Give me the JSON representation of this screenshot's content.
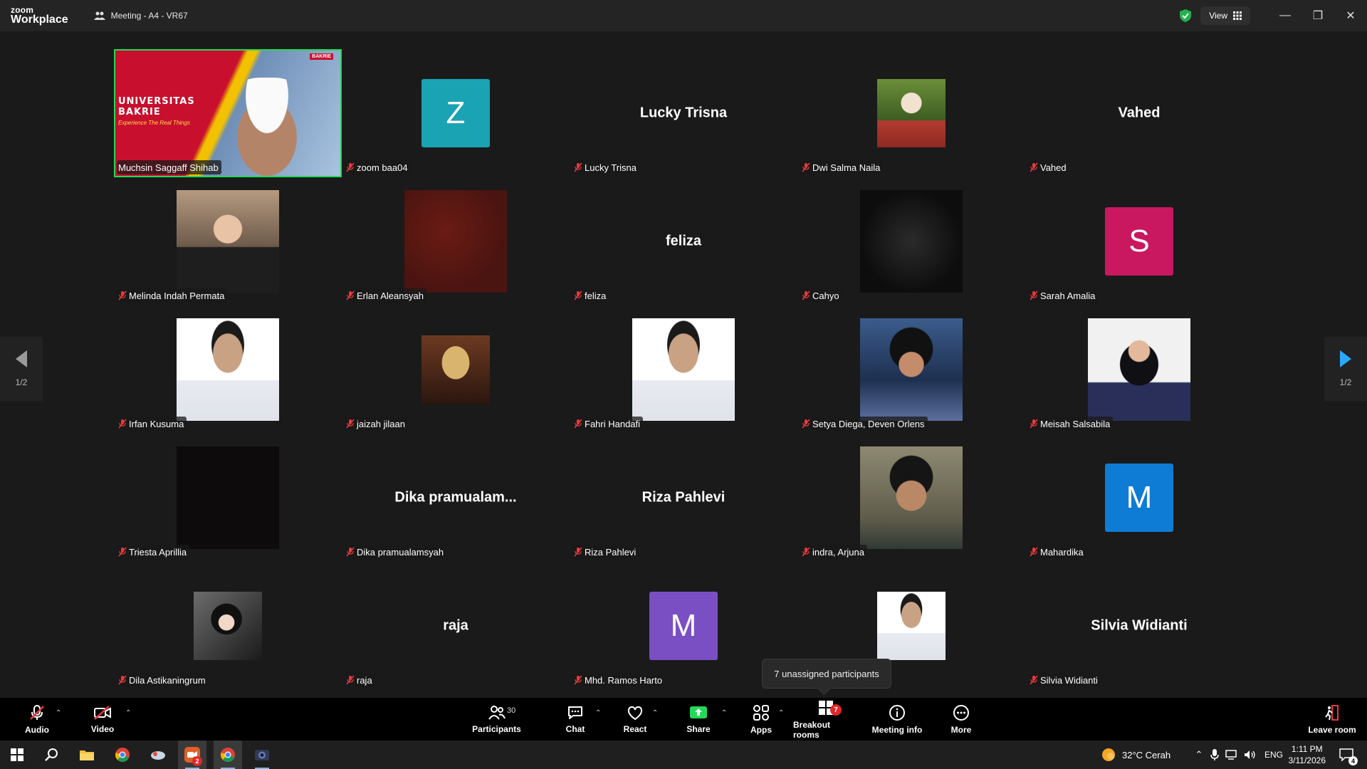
{
  "titlebar": {
    "brand_top": "zoom",
    "brand_bottom": "Workplace",
    "meeting_title": "Meeting - A4 - VR67",
    "view_label": "View"
  },
  "tiles": [
    {
      "name": "Muchsin Saggaff Shihab",
      "kind": "video",
      "theme": "univ",
      "active": true,
      "muted": false,
      "banner": {
        "line1": "UNIVERSITAS",
        "line2": "BAKRIE",
        "tagline": "Experience The Real Things",
        "logo": "BAKRIE"
      }
    },
    {
      "name": "zoom baa04",
      "kind": "avatar",
      "letter": "Z",
      "color": "#1aa3b3"
    },
    {
      "name": "Lucky Trisna",
      "kind": "text",
      "display": "Lucky Trisna"
    },
    {
      "name": "Dwi Salma Naila",
      "kind": "video",
      "theme": "grass",
      "small": true
    },
    {
      "name": "Vahed",
      "kind": "text",
      "display": "Vahed"
    },
    {
      "name": "Melinda Indah Permata",
      "kind": "video",
      "theme": "warm"
    },
    {
      "name": "Erlan Aleansyah",
      "kind": "video",
      "theme": "maroon"
    },
    {
      "name": "feliza",
      "kind": "text",
      "display": "feliza"
    },
    {
      "name": "Cahyo",
      "kind": "video",
      "theme": "batman"
    },
    {
      "name": "Sarah Amalia",
      "kind": "avatar",
      "letter": "S",
      "color": "#c9185f"
    },
    {
      "name": "Irfan Kusuma",
      "kind": "video",
      "theme": "white"
    },
    {
      "name": "jaizah jilaan",
      "kind": "video",
      "theme": "hijab",
      "small": true
    },
    {
      "name": "Fahri Handafi",
      "kind": "video",
      "theme": "white"
    },
    {
      "name": "Setya Diega, Deven Orlens",
      "kind": "video",
      "theme": "night"
    },
    {
      "name": "Meisah Salsabila",
      "kind": "video",
      "theme": "light"
    },
    {
      "name": "Triesta Aprillia",
      "kind": "video",
      "theme": "black"
    },
    {
      "name": "Dika pramualamsyah",
      "kind": "text",
      "display": "Dika  pramualam..."
    },
    {
      "name": "Riza Pahlevi",
      "kind": "text",
      "display": "Riza Pahlevi"
    },
    {
      "name": "indra, Arjuna",
      "kind": "video",
      "theme": "olive"
    },
    {
      "name": "Mahardika",
      "kind": "avatar",
      "letter": "M",
      "color": "#0e7cd4"
    },
    {
      "name": "Dila Astikaningrum",
      "kind": "video",
      "theme": "dark",
      "small": true
    },
    {
      "name": "raja",
      "kind": "text",
      "display": "raja"
    },
    {
      "name": "Mhd. Ramos Harto",
      "kind": "avatar",
      "letter": "M",
      "color": "#7b4fc4"
    },
    {
      "name": "",
      "kind": "video",
      "theme": "white",
      "small": true,
      "no_tag": true
    },
    {
      "name": "Silvia Widianti",
      "kind": "text",
      "display": "Silvia Widianti"
    }
  ],
  "nav": {
    "page_left": "1/2",
    "page_right": "1/2"
  },
  "tooltip": "7 unassigned participants",
  "toolbar": {
    "audio": "Audio",
    "video": "Video",
    "participants": "Participants",
    "participant_count": "30",
    "chat": "Chat",
    "react": "React",
    "share": "Share",
    "apps": "Apps",
    "breakout": "Breakout rooms",
    "breakout_badge": "7",
    "meeting_info": "Meeting info",
    "more": "More",
    "leave": "Leave room"
  },
  "taskbar": {
    "weather": "32°C  Cerah",
    "lang": "ENG",
    "time": "1:11 PM",
    "date": "3/11/2026",
    "zoom_badge": "2",
    "notif_count": "4"
  },
  "colors": {
    "accent_green": "#23d959",
    "share_green": "#23d959",
    "badge_red": "#e02828",
    "mute_red": "#e8383d"
  }
}
